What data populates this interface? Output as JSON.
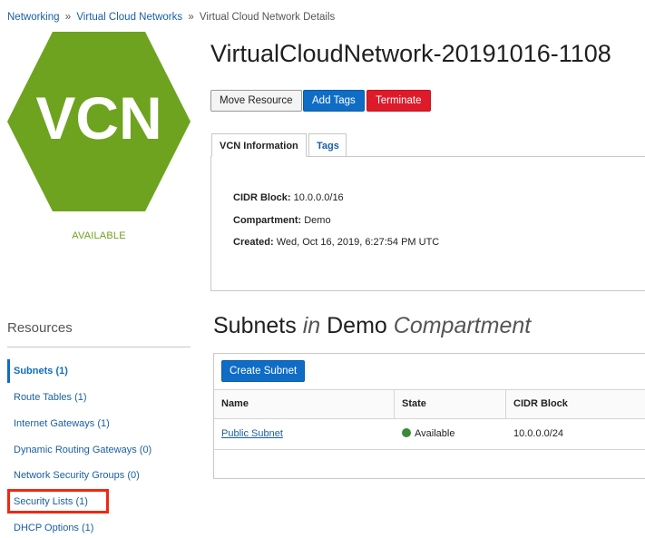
{
  "breadcrumb": {
    "items": [
      "Networking",
      "Virtual Cloud Networks",
      "Virtual Cloud Network Details"
    ],
    "separator": "»"
  },
  "vcn_badge": {
    "text": "VCN",
    "status": "AVAILABLE",
    "color": "#6ea31f"
  },
  "page_title": "VirtualCloudNetwork-20191016-1108",
  "actions": {
    "move": "Move Resource",
    "add_tags": "Add Tags",
    "terminate": "Terminate"
  },
  "tabs": [
    "VCN Information",
    "Tags"
  ],
  "vcn_info": {
    "cidr_label": "CIDR Block:",
    "cidr_value": "10.0.0.0/16",
    "compartment_label": "Compartment:",
    "compartment_value": "Demo",
    "created_label": "Created:",
    "created_value": "Wed, Oct 16, 2019, 6:27:54 PM UTC"
  },
  "resources": {
    "title": "Resources",
    "items": [
      "Subnets (1)",
      "Route Tables (1)",
      "Internet Gateways (1)",
      "Dynamic Routing Gateways (0)",
      "Network Security Groups (0)",
      "Security Lists (1)",
      "DHCP Options (1)"
    ]
  },
  "subnets": {
    "title_a": "Subnets",
    "title_b": "in",
    "title_c": "Demo",
    "title_d": "Compartment",
    "create_button": "Create Subnet",
    "columns": [
      "Name",
      "State",
      "CIDR Block"
    ],
    "rows": [
      {
        "name": "Public Subnet",
        "state": "Available",
        "cidr": "10.0.0.0/24"
      }
    ]
  },
  "colors": {
    "primary": "#0f6dc6",
    "danger": "#de1b2a",
    "link": "#1a5fa3",
    "highlight": "#f02811",
    "available_dot": "#3a8a3a"
  }
}
